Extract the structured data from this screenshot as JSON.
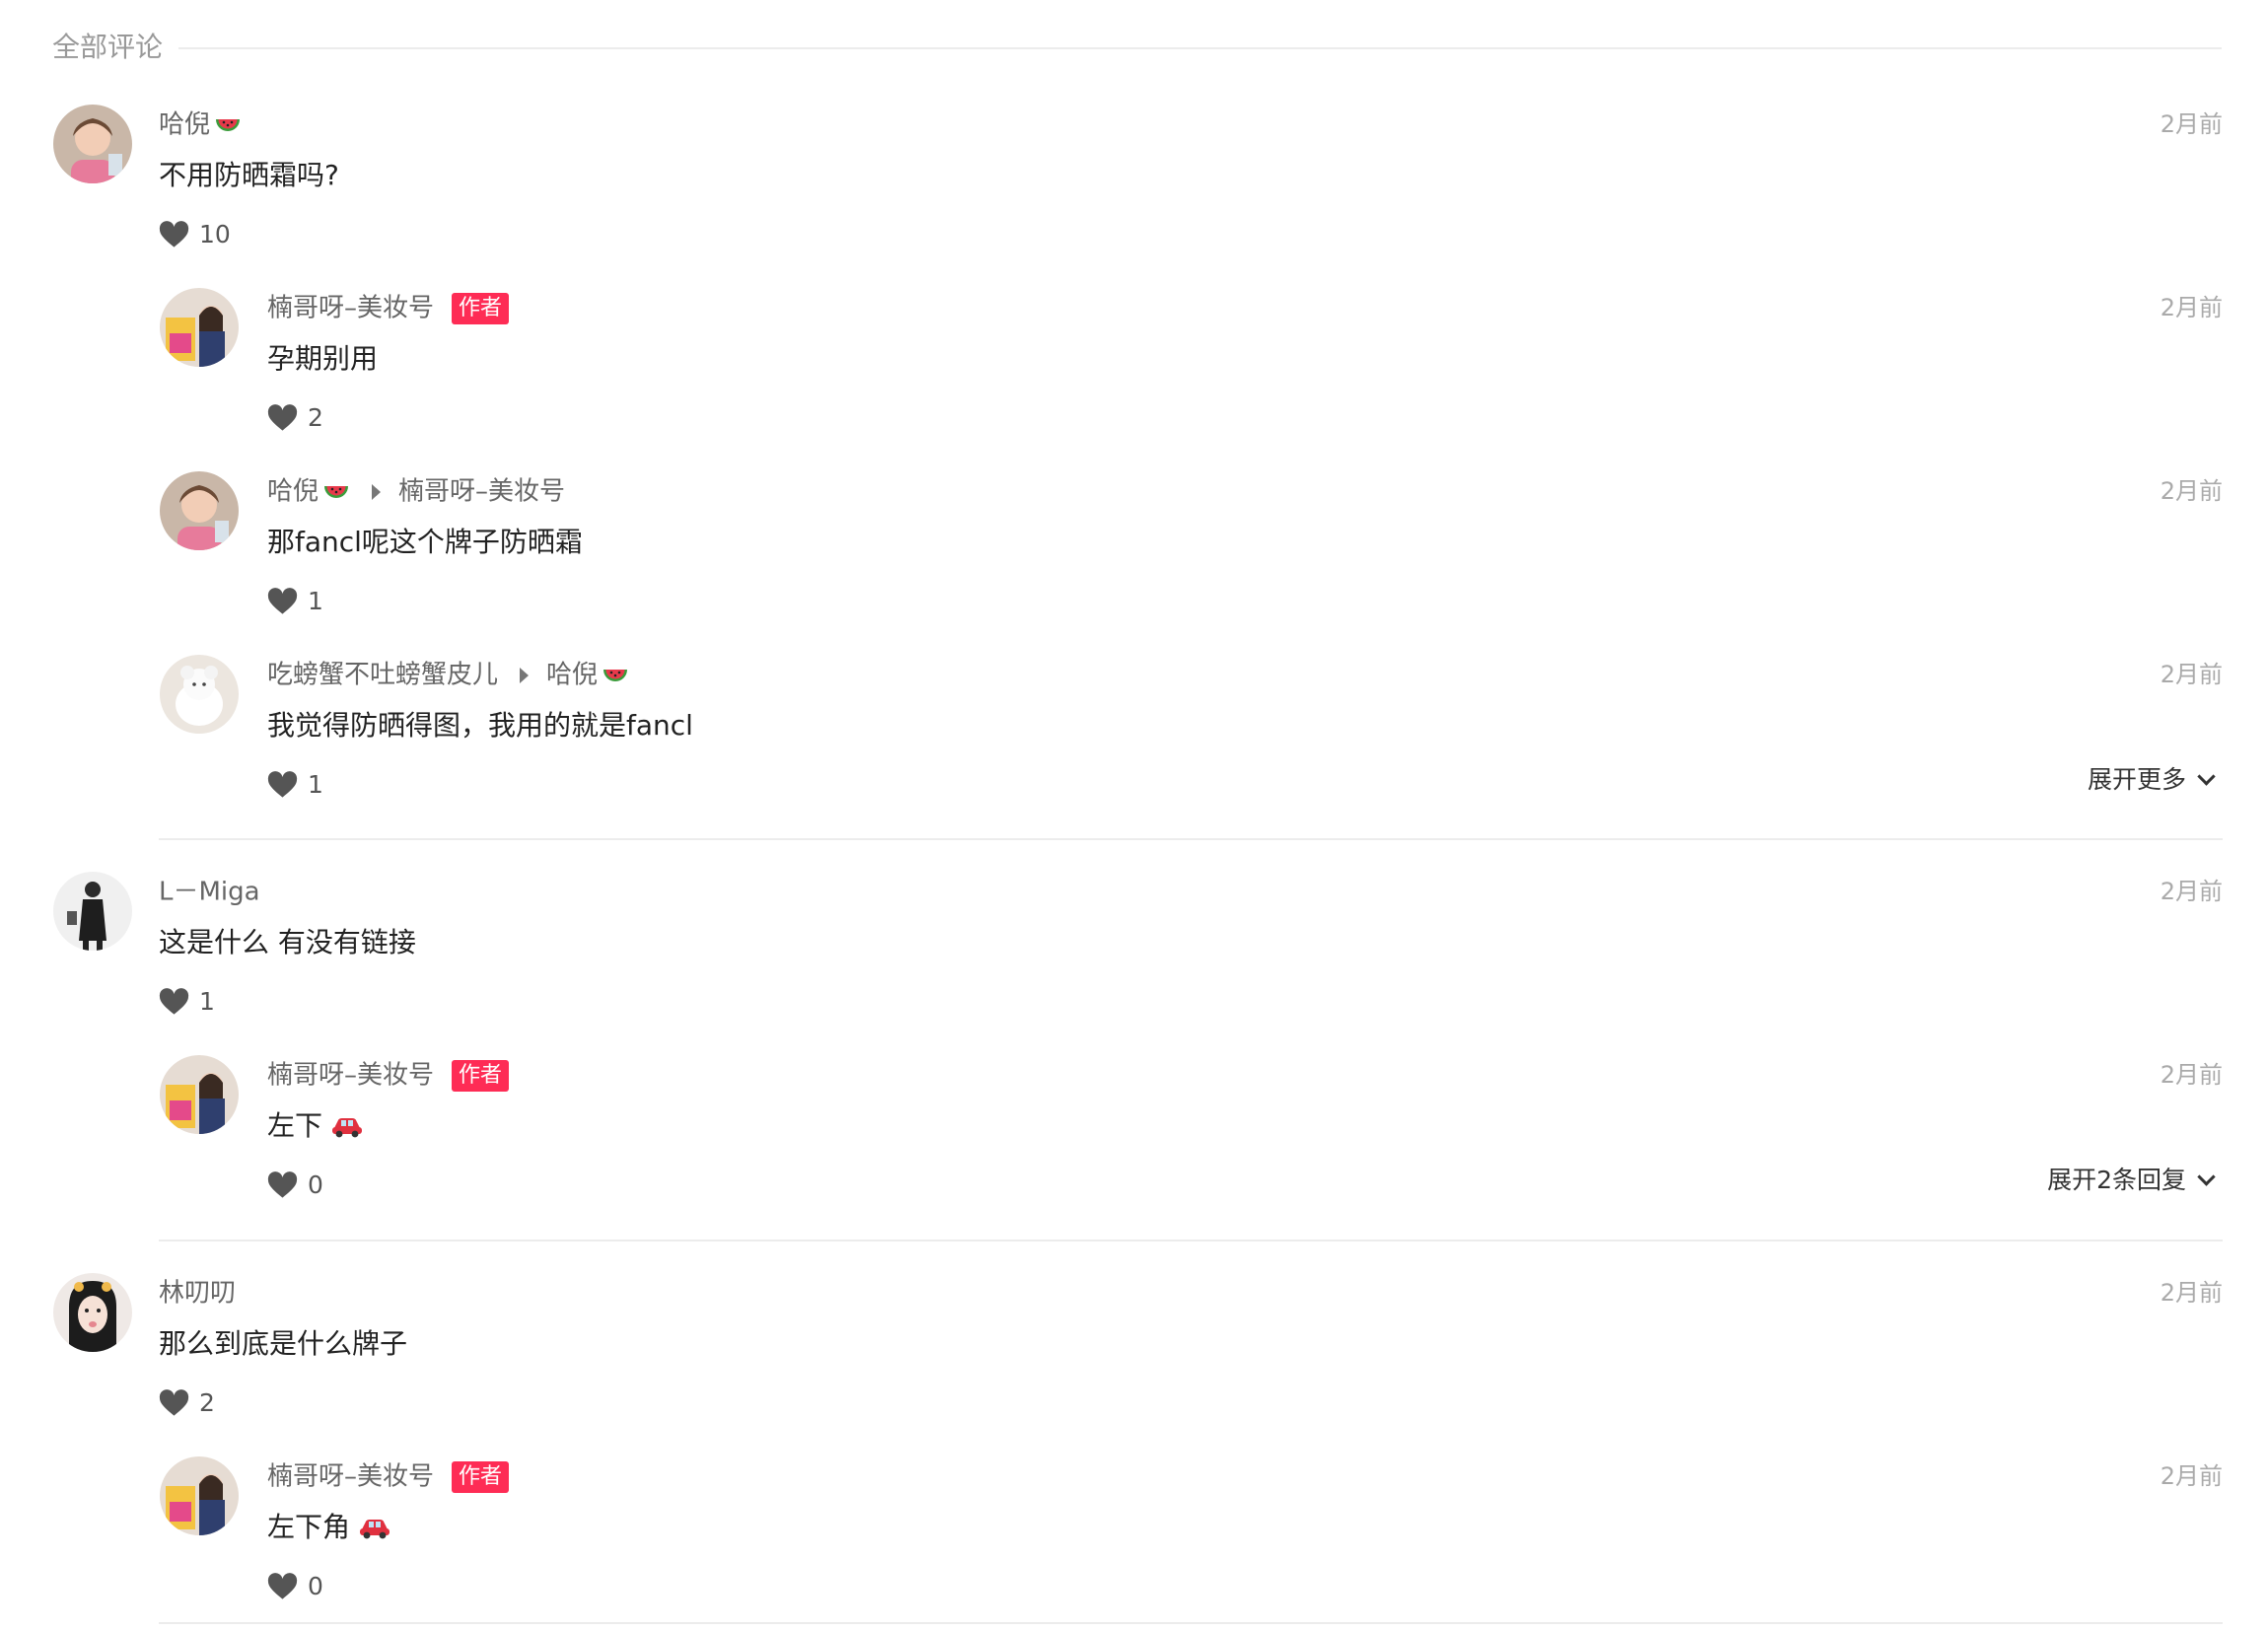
{
  "section": {
    "title": "全部评论"
  },
  "colors": {
    "badge": "#fe2c55",
    "muted": "#999999",
    "divider": "#ececec"
  },
  "threads": [
    {
      "main": {
        "user": "哈倪",
        "user_emoji": "watermelon-emoji",
        "time": "2月前",
        "text": "不用防晒霜吗?",
        "likes": "10"
      },
      "replies": [
        {
          "user": "楠哥呀–美妆号",
          "badge": "作者",
          "time": "2月前",
          "text": "孕期别用",
          "likes": "2"
        },
        {
          "user": "哈倪",
          "user_emoji": "watermelon-emoji",
          "reply_to": "楠哥呀–美妆号",
          "time": "2月前",
          "text": "那fancl呢这个牌子防晒霜",
          "likes": "1"
        },
        {
          "user": "吃螃蟹不吐螃蟹皮儿",
          "reply_to": "哈倪",
          "reply_to_emoji": "watermelon-emoji",
          "time": "2月前",
          "text": "我觉得防晒得图，我用的就是fancl",
          "likes": "1"
        }
      ],
      "expand_label": "展开更多"
    },
    {
      "main": {
        "user": "L－Miga",
        "time": "2月前",
        "text": "这是什么 有没有链接",
        "likes": "1"
      },
      "replies": [
        {
          "user": "楠哥呀–美妆号",
          "badge": "作者",
          "time": "2月前",
          "text": "左下",
          "text_emoji": "car-emoji",
          "likes": "0"
        }
      ],
      "expand_label": "展开2条回复"
    },
    {
      "main": {
        "user": "林叨叨",
        "time": "2月前",
        "text": "那么到底是什么牌子",
        "likes": "2"
      },
      "replies": [
        {
          "user": "楠哥呀–美妆号",
          "badge": "作者",
          "time": "2月前",
          "text": "左下角",
          "text_emoji": "car-emoji",
          "likes": "0"
        }
      ]
    }
  ]
}
